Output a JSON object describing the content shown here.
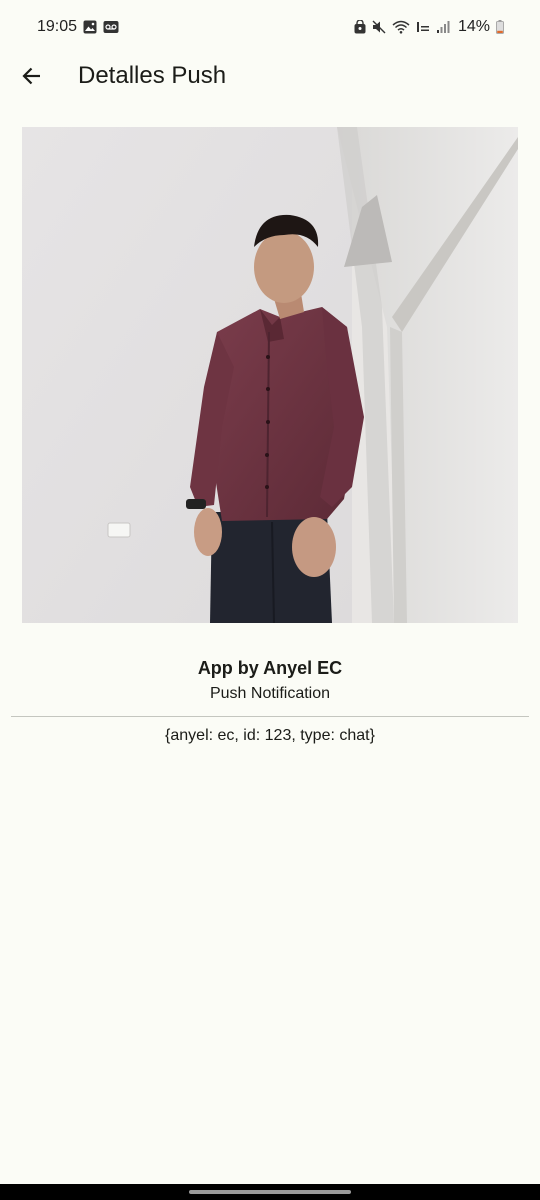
{
  "status_bar": {
    "time": "19:05",
    "left_icons": [
      "image-icon",
      "voicemail-icon"
    ],
    "right_icons": [
      "lock-icon",
      "mute-icon",
      "wifi-icon",
      "volte-icon",
      "signal-icon"
    ],
    "battery": "14%"
  },
  "app_bar": {
    "back_icon": "arrow-back-icon",
    "title": "Detalles Push"
  },
  "notification": {
    "title": "App by Anyel EC",
    "body": "Push Notification",
    "data": "{anyel: ec, id: 123, type: chat}"
  },
  "colors": {
    "background": "#fbfcf6",
    "divider": "#c4c6bf",
    "text": "#1b1c18",
    "shirt": "#6b3240"
  }
}
